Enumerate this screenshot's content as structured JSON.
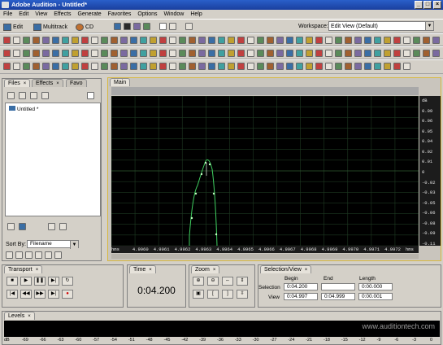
{
  "window": {
    "title": "Adobe Audition - Untitled*",
    "buttons": [
      "_",
      "□",
      "×"
    ]
  },
  "menu": [
    "File",
    "Edit",
    "View",
    "Effects",
    "Generate",
    "Favorites",
    "Options",
    "Window",
    "Help"
  ],
  "toolbar": {
    "edit_label": "Edit",
    "multitrack_label": "Multitrack",
    "cd_label": "CD",
    "workspace_label": "Workspace:",
    "workspace_value": "Edit View (Default)"
  },
  "files_panel": {
    "tabs": [
      "Files",
      "Effects",
      "Favo"
    ],
    "items": [
      "Untitled *"
    ],
    "sort_label": "Sort By:",
    "sort_value": "Filename"
  },
  "main_panel": {
    "tab": "Main",
    "y_labels": [
      "dB",
      "0.09",
      "0.06",
      "0.05",
      "0.04",
      "0.02",
      "0.01",
      "0",
      "-0.02",
      "-0.03",
      "-0.05",
      "-0.06",
      "-0.08",
      "-0.09",
      "-0.11"
    ],
    "x_labels": [
      "hms",
      "4.9960",
      "4.9961",
      "4.9962",
      "4.9963",
      "4.9964",
      "4.9965",
      "4.9966",
      "4.9967",
      "4.9968",
      "4.9969",
      "4.9970",
      "4.9971",
      "4.9972",
      "hms"
    ]
  },
  "transport": {
    "tab": "Transport"
  },
  "time": {
    "tab": "Time",
    "value": "0:04.200"
  },
  "zoom": {
    "tab": "Zoom"
  },
  "selection": {
    "tab": "Selection/View",
    "headers": [
      "Begin",
      "End",
      "Length"
    ],
    "rows": [
      {
        "label": "Selection",
        "begin": "0:04.200",
        "end": "",
        "length": "0:00.000"
      },
      {
        "label": "View",
        "begin": "0:04.997",
        "end": "0:04.999",
        "length": "0:00.001"
      }
    ]
  },
  "levels": {
    "tab": "Levels",
    "scale": [
      "dB",
      "-69",
      "-66",
      "-63",
      "-60",
      "-57",
      "-54",
      "-51",
      "-48",
      "-45",
      "-42",
      "-39",
      "-36",
      "-33",
      "-30",
      "-27",
      "-24",
      "-21",
      "-18",
      "-15",
      "-12",
      "-9",
      "-6",
      "-3",
      "0"
    ]
  },
  "watermark": "www.auditiontech.com"
}
